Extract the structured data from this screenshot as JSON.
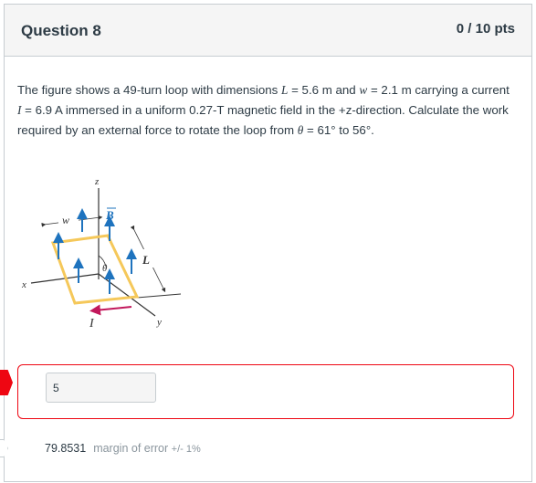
{
  "question": {
    "title": "Question 8",
    "points": "0 / 10 pts",
    "text_1": "The figure shows a 49-turn loop with dimensions ",
    "var_L": "L",
    "text_2": " = 5.6 m and ",
    "var_w": "w",
    "text_3": " = 2.1 m carrying a current ",
    "var_I": "I",
    "text_4": " = 6.9 A immersed in a uniform 0.27-T magnetic field in the +z-direction. Calculate the work required by an external force to rotate the loop from ",
    "var_theta": "θ",
    "text_5": " = 61° to 56°."
  },
  "figure": {
    "z_label": "z",
    "w_label": "w",
    "B_label": "B",
    "theta_label": "θ",
    "L_label": "L",
    "x_label": "x",
    "I_label": "I",
    "y_label": "y",
    "colors": {
      "loop": "#f5c85a",
      "field_arrow": "#1e73be",
      "current_arrow": "#c2185b",
      "axis": "#333333"
    }
  },
  "answer": {
    "value": "5",
    "status_color": "#ee0612"
  },
  "correct": {
    "value": "79.8531",
    "margin_label": "margin of error",
    "margin_value": "+/- 1%"
  }
}
